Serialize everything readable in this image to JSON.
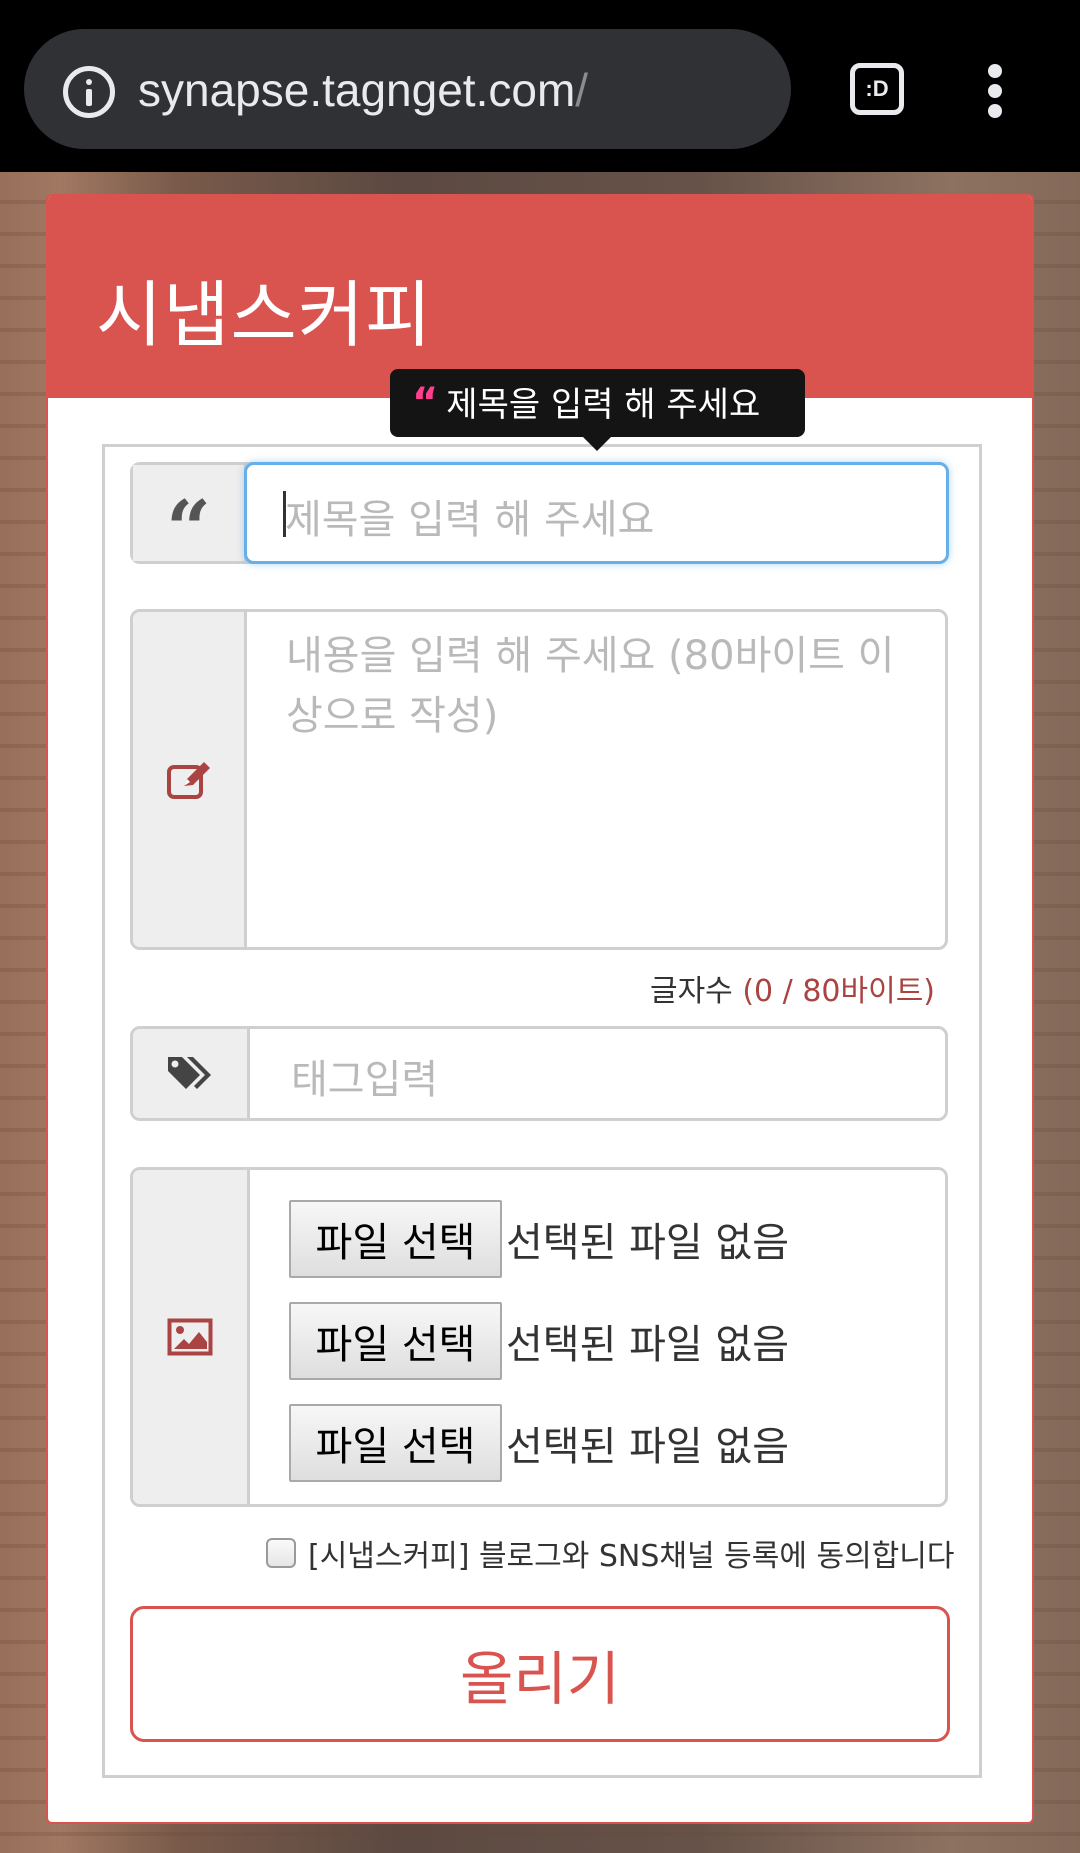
{
  "browser": {
    "url": "synapse.tagnget.com",
    "url_suffix": "/",
    "tab_icon_label": ":D",
    "icons": [
      "info-icon",
      "tab-switcher-icon",
      "more-vert-icon"
    ]
  },
  "card": {
    "title": "시냅스커피",
    "accent_color": "#d9534f"
  },
  "tooltip": {
    "text": "제목을 입력 해 주세요"
  },
  "form": {
    "title_field": {
      "placeholder": "제목을 입력 해 주세요",
      "value": "",
      "icon": "quote-icon"
    },
    "content_field": {
      "placeholder": "내용을 입력 해 주세요 (80바이트 이상으로 작성)",
      "value": "",
      "icon": "edit-icon"
    },
    "counter": {
      "label": "글자수",
      "value": "(0 / 80바이트)"
    },
    "tag_field": {
      "placeholder": "태그입력",
      "value": "",
      "icon": "tags-icon"
    },
    "files": {
      "icon": "image-icon",
      "items": [
        {
          "button_label": "파일 선택",
          "status": "선택된 파일 없음"
        },
        {
          "button_label": "파일 선택",
          "status": "선택된 파일 없음"
        },
        {
          "button_label": "파일 선택",
          "status": "선택된 파일 없음"
        }
      ]
    },
    "agree": {
      "label": "[시냅스커피] 블로그와 SNS채널 등록에 동의합니다",
      "checked": false
    },
    "submit_label": "올리기"
  }
}
